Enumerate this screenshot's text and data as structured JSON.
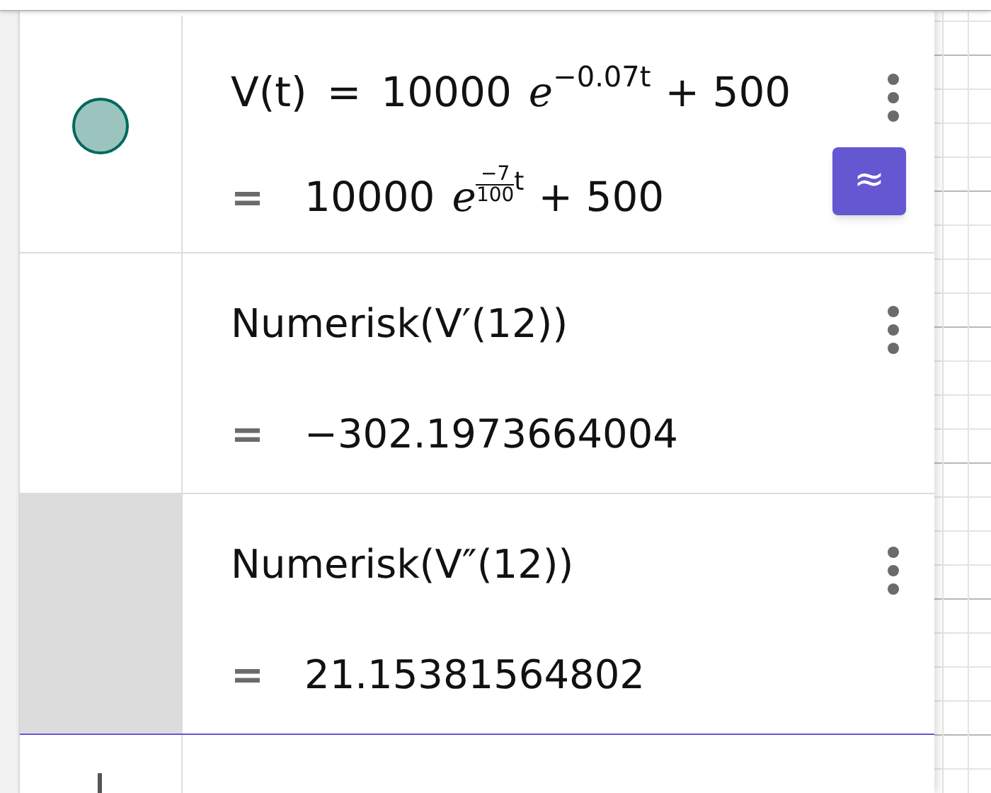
{
  "rows": [
    {
      "kind": "function",
      "selected": false,
      "visible": true,
      "lhs": "V(t)",
      "lhs_equals": "=",
      "coef": "10000",
      "base": "e",
      "exponent": "−0.07t",
      "tail": "+ 500",
      "equals": "=",
      "out_coef": "10000",
      "out_base": "e",
      "out_num": "−7",
      "out_den": "100",
      "out_var": "t",
      "out_tail": "+ 500",
      "approx_button": "≈"
    },
    {
      "kind": "command",
      "selected": false,
      "text": "Numerisk(V′(12))",
      "equals": "=",
      "result": "−302.1973664004"
    },
    {
      "kind": "command",
      "selected": true,
      "text": "Numerisk(V″(12))",
      "equals": "=",
      "result": "21.15381564802"
    }
  ]
}
